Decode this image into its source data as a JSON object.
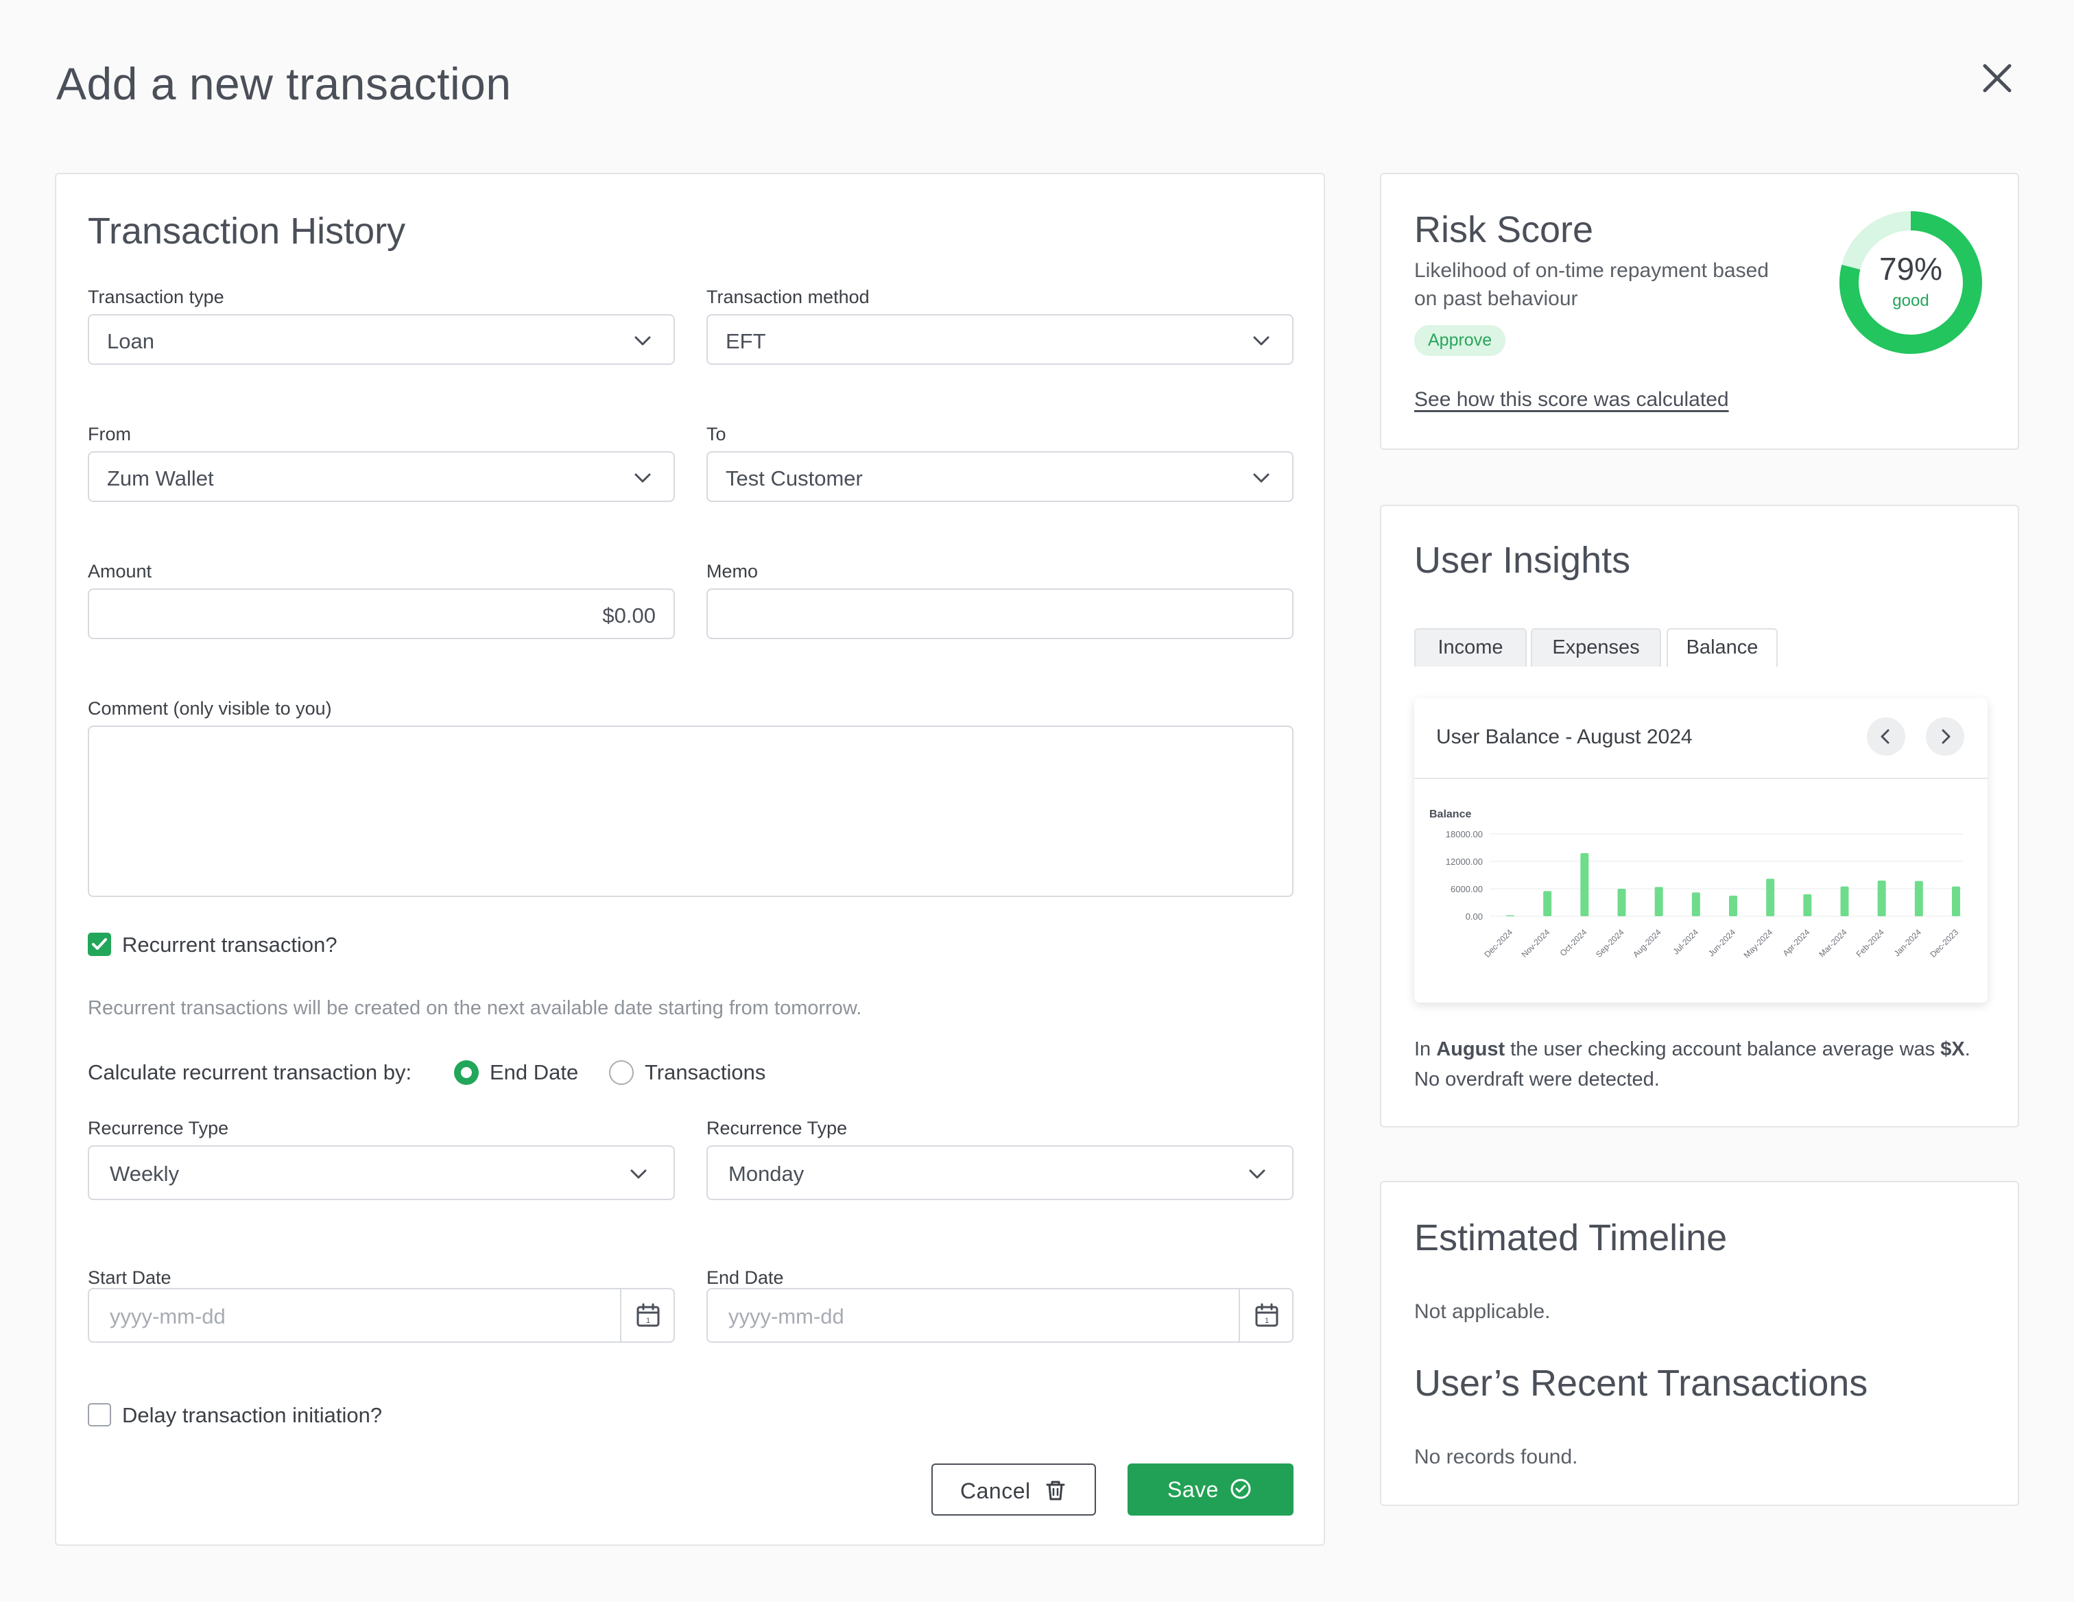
{
  "header": {
    "title": "Add a new transaction"
  },
  "form": {
    "title": "Transaction History",
    "transaction_type": {
      "label": "Transaction type",
      "value": "Loan"
    },
    "transaction_method": {
      "label": "Transaction method",
      "value": "EFT"
    },
    "from": {
      "label": "From",
      "value": "Zum Wallet"
    },
    "to": {
      "label": "To",
      "value": "Test Customer"
    },
    "amount": {
      "label": "Amount",
      "value": "$0.00"
    },
    "memo": {
      "label": "Memo",
      "value": ""
    },
    "comment": {
      "label": "Comment (only visible to you)",
      "value": ""
    },
    "recurrent": {
      "label": "Recurrent transaction?",
      "checked": true
    },
    "recurrent_hint": "Recurrent transactions will be created on the next available date starting from tomorrow.",
    "calc_by": {
      "label": "Calculate recurrent transaction by:",
      "options": [
        "End Date",
        "Transactions"
      ],
      "selected": "End Date"
    },
    "recurrence_type_1": {
      "label": "Recurrence Type",
      "value": "Weekly"
    },
    "recurrence_type_2": {
      "label": "Recurrence Type",
      "value": "Monday"
    },
    "start_date": {
      "label": "Start Date",
      "placeholder": "yyyy-mm-dd"
    },
    "end_date": {
      "label": "End Date",
      "placeholder": "yyyy-mm-dd"
    },
    "delay": {
      "label": "Delay transaction initiation?",
      "checked": false
    },
    "cancel_label": "Cancel",
    "save_label": "Save"
  },
  "risk": {
    "title": "Risk Score",
    "description": "Likelihood of on-time repayment based on past behaviour",
    "badge": "Approve",
    "score_percent": 79,
    "score_text": "79%",
    "score_grade": "good",
    "link": "See how this score was calculated",
    "colors": {
      "ring": "#22c55e",
      "ring_bg": "#d9f5e3"
    }
  },
  "insights": {
    "title": "User Insights",
    "tabs": [
      {
        "label": "Income",
        "active": false
      },
      {
        "label": "Expenses",
        "active": false
      },
      {
        "label": "Balance",
        "active": true
      }
    ],
    "chart_title": "User Balance - August 2024",
    "summary_prefix": "In ",
    "summary_month": "August",
    "summary_mid": " the user checking account balance average was ",
    "summary_amount": "$X",
    "summary_suffix": ". No overdraft were detected."
  },
  "chart_data": {
    "type": "bar",
    "ylabel": "Balance",
    "ylim": [
      0,
      18000
    ],
    "yticks": [
      "18000.00",
      "12000.00",
      "6000.00",
      "0.00"
    ],
    "categories": [
      "Dec-2024",
      "Nov-2024",
      "Oct-2024",
      "Sep-2024",
      "Aug-2024",
      "Jul-2024",
      "Jun-2024",
      "May-2024",
      "Apr-2024",
      "Mar-2024",
      "Feb-2024",
      "Jan-2024",
      "Dec-2023"
    ],
    "values": [
      200,
      5500,
      13800,
      6000,
      6400,
      5200,
      4500,
      8200,
      4800,
      6500,
      7800,
      7700,
      6500
    ],
    "grid": true,
    "bar_color": "#6fdc8c"
  },
  "timeline": {
    "title": "Estimated Timeline",
    "text": "Not applicable.",
    "recent_title": "User’s Recent Transactions",
    "recent_text": "No records found."
  }
}
